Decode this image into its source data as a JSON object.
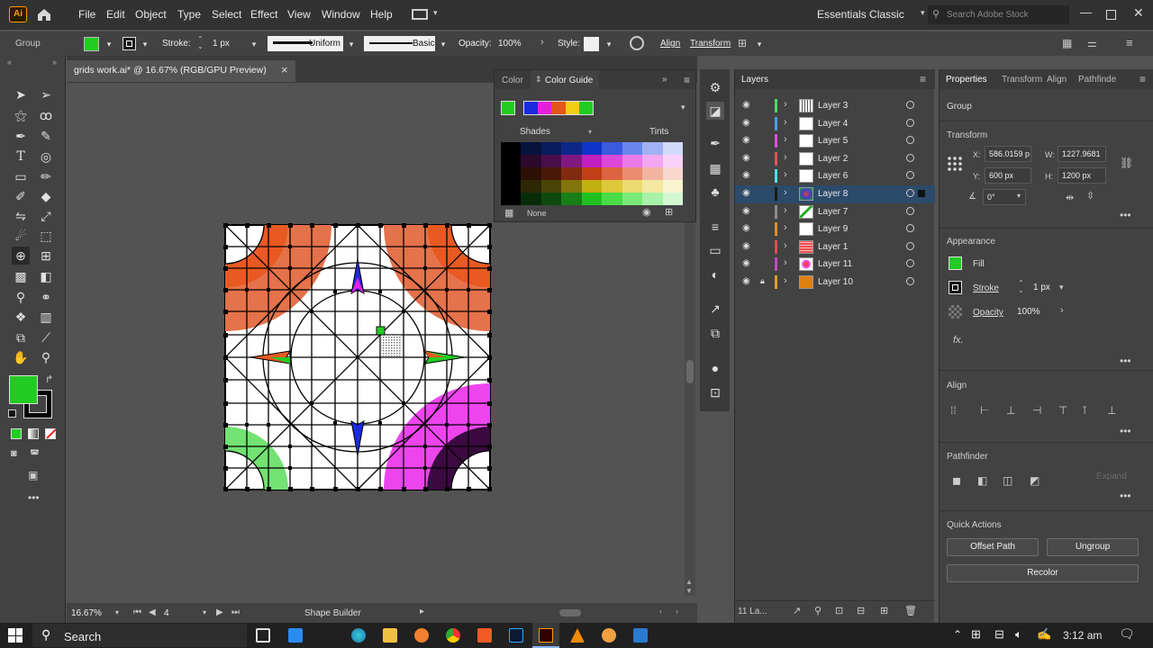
{
  "menubar": {
    "logo": "Ai",
    "items": [
      "File",
      "Edit",
      "Object",
      "Type",
      "Select",
      "Effect",
      "View",
      "Window",
      "Help"
    ],
    "workspace": "Essentials Classic",
    "search_placeholder": "Search Adobe Stock"
  },
  "controlbar": {
    "selection_type": "Group",
    "stroke_label": "Stroke:",
    "stroke_value": "1 px",
    "profile_label": "Uniform",
    "brush_label": "Basic",
    "opacity_label": "Opacity:",
    "opacity_value": "100%",
    "style_label": "Style:",
    "align_label": "Align",
    "transform_label": "Transform"
  },
  "document": {
    "tab_title": "grids work.ai* @ 16.67% (RGB/GPU Preview)",
    "close": "×"
  },
  "colorguide": {
    "tab_color": "Color",
    "tab_guide": "Color Guide",
    "shades_label": "Shades",
    "tints_label": "Tints",
    "none_label": "None",
    "active_color": "#22cc22",
    "harmony_colors": [
      "#1a2bdc",
      "#e41fe0",
      "#e4561a",
      "#f0d010",
      "#22cc22"
    ],
    "grid_rows": [
      [
        "#000000",
        "#06133c",
        "#091c5c",
        "#0c2788",
        "#1134c8",
        "#3a5ae0",
        "#6a86ec",
        "#a0b2f4",
        "#d0dbfa"
      ],
      [
        "#000000",
        "#2c0a2c",
        "#4a0f4a",
        "#801880",
        "#c020c0",
        "#dc48dc",
        "#ea7aea",
        "#f2a8f2",
        "#f8d2f8"
      ],
      [
        "#000000",
        "#2c1005",
        "#4a1808",
        "#802a10",
        "#c04018",
        "#dc6440",
        "#ea8c70",
        "#f2b4a0",
        "#f8d8cc"
      ],
      [
        "#000000",
        "#2c2803",
        "#4a4406",
        "#80740a",
        "#c0b010",
        "#dcc838",
        "#eada70",
        "#f2e8a0",
        "#f8f4d0"
      ],
      [
        "#000000",
        "#082c08",
        "#0e4a0e",
        "#168016",
        "#20c020",
        "#48dc48",
        "#78ea78",
        "#a8f2a8",
        "#d4f8d4"
      ]
    ]
  },
  "status": {
    "zoom": "16.67%",
    "page": "4",
    "tool": "Shape Builder"
  },
  "layers": {
    "title": "Layers",
    "footer_count": "11 La...",
    "rows": [
      {
        "name": "Layer 3",
        "color": "#4cd864",
        "thumb": "#888888",
        "selected": false,
        "locked": false
      },
      {
        "name": "Layer 4",
        "color": "#4c9cf0",
        "thumb": "#ffffff",
        "selected": false,
        "locked": false
      },
      {
        "name": "Layer 5",
        "color": "#e04ce0",
        "thumb": "#ffffff",
        "selected": false,
        "locked": false
      },
      {
        "name": "Layer 2",
        "color": "#e05454",
        "thumb": "#ffffff",
        "selected": false,
        "locked": false
      },
      {
        "name": "Layer 6",
        "color": "#4ce0e0",
        "thumb": "#ffffff",
        "selected": false,
        "locked": false
      },
      {
        "name": "Layer 8",
        "color": "#1a1a1a",
        "thumb": "#c04040",
        "selected": true,
        "locked": false
      },
      {
        "name": "Layer 7",
        "color": "#8c8c8c",
        "thumb": "#ffffff",
        "selected": false,
        "locked": false
      },
      {
        "name": "Layer 9",
        "color": "#e08c2c",
        "thumb": "#ffffff",
        "selected": false,
        "locked": false
      },
      {
        "name": "Layer 1",
        "color": "#e04c4c",
        "thumb": "#e85050",
        "selected": false,
        "locked": false
      },
      {
        "name": "Layer 11",
        "color": "#c04cc0",
        "thumb": "#e0e0e0",
        "selected": false,
        "locked": false
      },
      {
        "name": "Layer 10",
        "color": "#e0a02c",
        "thumb": "#e08010",
        "selected": false,
        "locked": true
      }
    ]
  },
  "properties": {
    "tabs": [
      "Properties",
      "Transform",
      "Align",
      "Pathfinde"
    ],
    "group_label": "Group",
    "transform_title": "Transform",
    "x_label": "X:",
    "x_value": "586.0159 p",
    "w_label": "W:",
    "w_value": "1227.9681",
    "y_label": "Y:",
    "y_value": "600 px",
    "h_label": "H:",
    "h_value": "1200 px",
    "angle_value": "0°",
    "appearance_title": "Appearance",
    "fill_label": "Fill",
    "fill_color": "#22cc22",
    "stroke_label": "Stroke",
    "stroke_value": "1 px",
    "opacity_label": "Opacity",
    "opacity_value": "100%",
    "fx_label": "fx.",
    "align_title": "Align",
    "pathfinder_title": "Pathfinder",
    "expand_label": "Expand",
    "quick_actions_title": "Quick Actions",
    "offset_path_label": "Offset Path",
    "ungroup_label": "Ungroup",
    "recolor_label": "Recolor"
  },
  "taskbar": {
    "search_label": "Search",
    "time": "3:12 am"
  },
  "toolbar": {
    "fill_color": "#22cc22",
    "stroke_color": "#000000"
  }
}
